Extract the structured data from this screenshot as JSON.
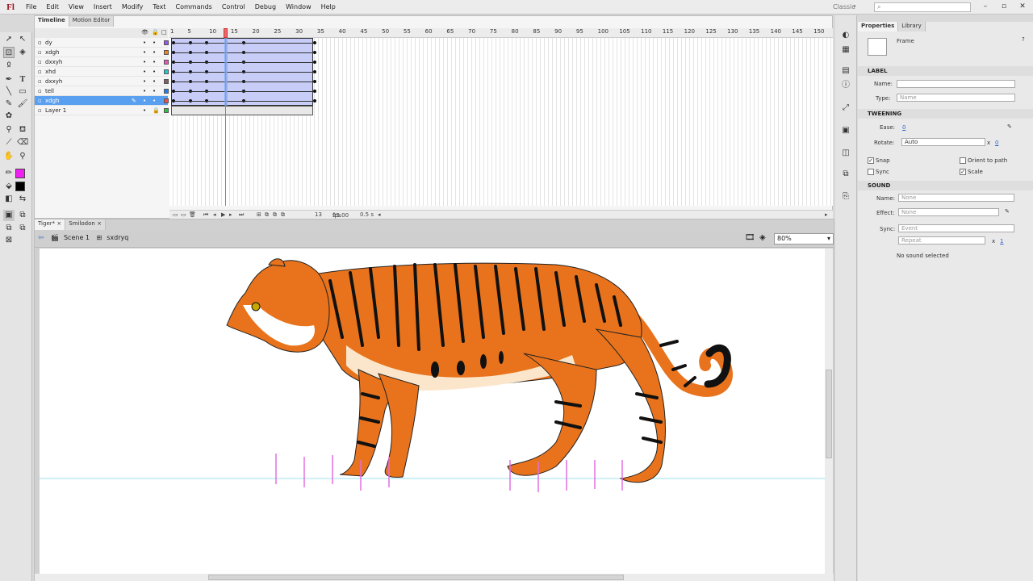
{
  "menu": [
    "File",
    "Edit",
    "View",
    "Insert",
    "Modify",
    "Text",
    "Commands",
    "Control",
    "Debug",
    "Window",
    "Help"
  ],
  "app_logo": "Fl",
  "workspace": "Classic",
  "timeline": {
    "tabs": [
      "Timeline",
      "Motion Editor"
    ],
    "layers": [
      {
        "name": "dy",
        "color": "#a050f0"
      },
      {
        "name": "xdgh",
        "color": "#f08020"
      },
      {
        "name": "dxxyh",
        "color": "#f050c0"
      },
      {
        "name": "xhd",
        "color": "#20c8d8"
      },
      {
        "name": "dxxyh",
        "color": "#806060"
      },
      {
        "name": "tell",
        "color": "#2080f0"
      },
      {
        "name": "xdgh",
        "color": "#f05050"
      },
      {
        "name": "Layer 1",
        "color": "#30c040"
      }
    ],
    "selected_layer": 6,
    "ruler_ticks": [
      "1",
      "5",
      "10",
      "15",
      "20",
      "25",
      "30",
      "35",
      "40",
      "45",
      "50",
      "55",
      "60",
      "65",
      "70",
      "75",
      "80",
      "85",
      "90",
      "95",
      "100",
      "105",
      "110",
      "115",
      "120",
      "125",
      "130",
      "135",
      "140",
      "145",
      "150"
    ],
    "fps": "25.00",
    "fps_unit": "fps",
    "current_frame": "13",
    "time": "0.5 s"
  },
  "docs": {
    "tabs": [
      "Tiger*",
      "Smilodon"
    ],
    "scene": "Scene 1",
    "symbol": "sxdryq",
    "zoom": "80%"
  },
  "properties": {
    "tabs": [
      "Properties",
      "Library"
    ],
    "kind": "Frame",
    "label_section": "LABEL",
    "name_label": "Name:",
    "type_label": "Type:",
    "type_value": "Name",
    "tweening_section": "TWEENING",
    "ease_label": "Ease:",
    "ease_value": "0",
    "rotate_label": "Rotate:",
    "rotate_value": "Auto",
    "rotate_times_x": "x",
    "rotate_times": "0",
    "snap": "Snap",
    "orient": "Orient to path",
    "sync": "Sync",
    "scale": "Scale",
    "sound_section": "SOUND",
    "sname_label": "Name:",
    "sname_value": "None",
    "effect_label": "Effect:",
    "effect_value": "None",
    "ssync_label": "Sync:",
    "ssync_value": "Event",
    "repeat_value": "Repeat",
    "repeat_times_x": "x",
    "repeat_times": "1",
    "no_sound": "No sound selected"
  },
  "colors": {
    "stroke": "#f020f0",
    "fill": "#000000",
    "tiger_orange": "#e8731c",
    "belly": "#fbe6cb"
  },
  "icons": [
    "arrow-icon",
    "subselect-icon",
    "free-transform-icon",
    "lasso-icon",
    "pen-icon",
    "text-icon",
    "line-icon",
    "rectangle-icon",
    "pencil-icon",
    "brush-icon",
    "bone-icon",
    "paint-bucket-icon",
    "eyedropper-icon",
    "eraser-icon",
    "hand-icon",
    "zoom-icon"
  ]
}
